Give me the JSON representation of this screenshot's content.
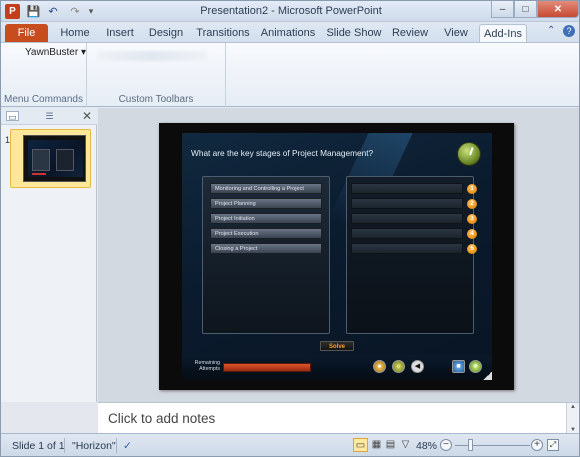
{
  "window": {
    "title": "Presentation2 - Microsoft PowerPoint",
    "app_icon": "P",
    "qat_icons": [
      "save-icon",
      "undo-icon",
      "redo-icon",
      "customize-qat-icon"
    ],
    "controls": {
      "minimize": "–",
      "maximize": "□",
      "close": "✕"
    }
  },
  "tabs": [
    {
      "label": "File",
      "key": "file"
    },
    {
      "label": "Home",
      "key": "home"
    },
    {
      "label": "Insert",
      "key": "insert"
    },
    {
      "label": "Design",
      "key": "design"
    },
    {
      "label": "Transitions",
      "key": "transitions"
    },
    {
      "label": "Animations",
      "key": "animations"
    },
    {
      "label": "Slide Show",
      "key": "slide-show"
    },
    {
      "label": "Review",
      "key": "review"
    },
    {
      "label": "View",
      "key": "view"
    },
    {
      "label": "Add-Ins",
      "key": "add-ins",
      "active": true
    }
  ],
  "ribbon": {
    "yawnbuster_label": "YawnBuster ▾",
    "groups": {
      "menu_commands": "Menu Commands",
      "custom_toolbars": "Custom Toolbars"
    }
  },
  "slides_pane": {
    "close_glyph": "✕",
    "thumbnails": [
      {
        "number": "1",
        "selected": true
      }
    ]
  },
  "slide": {
    "question": "What are the key stages of Project Management?",
    "options": [
      "Monitoring and Controlling a Project",
      "Project Planning",
      "Project Initiation",
      "Project Execution",
      "Closing a Project"
    ],
    "slot_numbers": [
      "1",
      "2",
      "3",
      "4",
      "5"
    ],
    "solve_label": "Solve",
    "remaining_attempts_label": "Remaining Attempts",
    "remaining_attempts_fraction": 1.0
  },
  "notes": {
    "placeholder": "Click to add notes"
  },
  "status": {
    "slide_info": "Slide 1 of 1",
    "theme": "\"Horizon\"",
    "zoom": "48%",
    "zoom_out": "−",
    "zoom_in": "+"
  }
}
